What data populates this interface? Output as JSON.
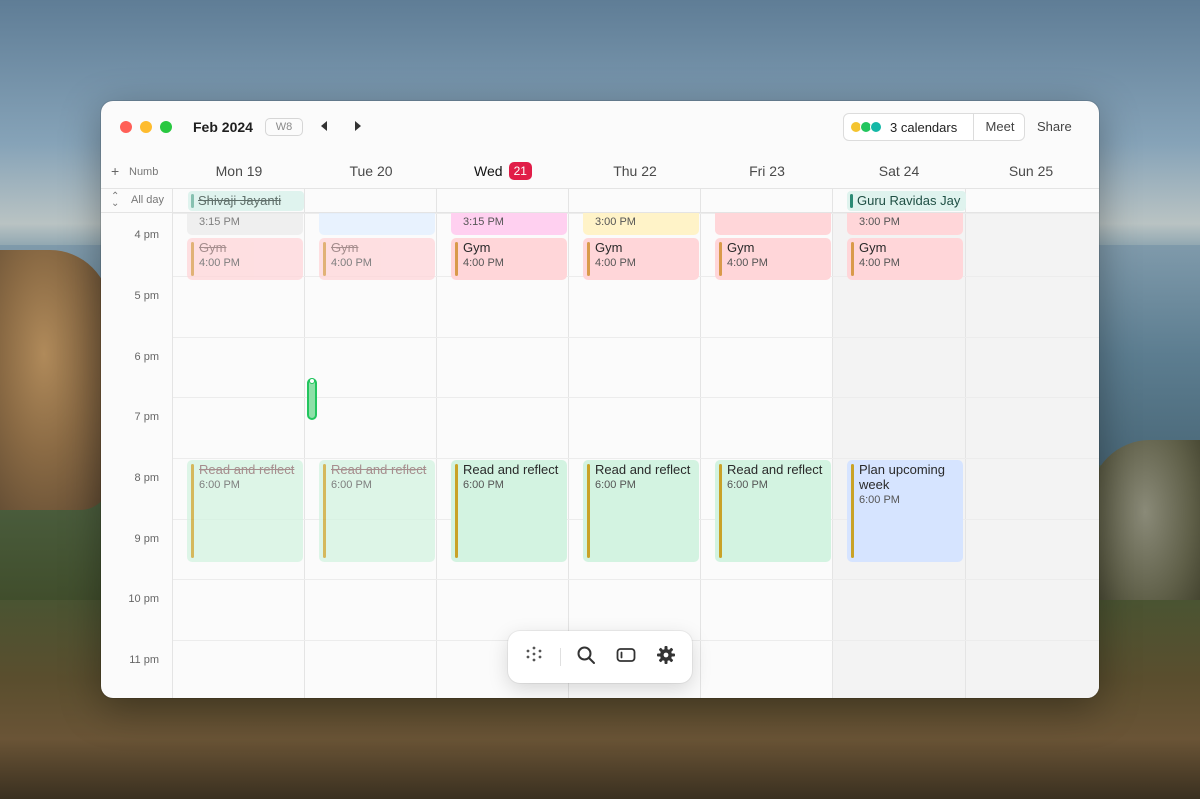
{
  "window": {
    "month": "Feb 2024",
    "week": "W8",
    "calendars_label": "3 calendars",
    "meet_label": "Meet",
    "share_label": "Share"
  },
  "header": {
    "add_label": "+",
    "numb_label": "Numb",
    "days": [
      "Mon 19",
      "Tue 20",
      "Wed",
      "Thu 22",
      "Fri 23",
      "Sat 24",
      "Sun 25"
    ],
    "today_number": "21"
  },
  "allday": {
    "label": "All day",
    "events": [
      {
        "title": "Shivaji Jayanti",
        "day": "Mon 19"
      },
      {
        "title": "Guru Ravidas Jay",
        "day": "Sat 24"
      }
    ]
  },
  "hours": [
    "4 pm",
    "5 pm",
    "6 pm",
    "7 pm",
    "8 pm",
    "9 pm",
    "10 pm",
    "11 pm"
  ],
  "events": {
    "top_times": [
      "3:15 PM",
      "3:15 PM",
      "3:00 PM",
      "3:00 PM"
    ],
    "gym": {
      "title": "Gym",
      "time": "4:00 PM"
    },
    "read": {
      "title": "Read and reflect",
      "time": "6:00 PM"
    },
    "plan": {
      "title": "Plan upcoming week",
      "time": "6:00 PM"
    }
  },
  "toolbar": {
    "items": [
      "apps-icon",
      "search-icon",
      "window-icon",
      "gear-icon"
    ]
  },
  "colors": {
    "today": "#e11d48",
    "gym": "#ffd6d9",
    "read": "#d3f3e1",
    "plan": "#d6e4ff",
    "now": "#22c55e"
  }
}
